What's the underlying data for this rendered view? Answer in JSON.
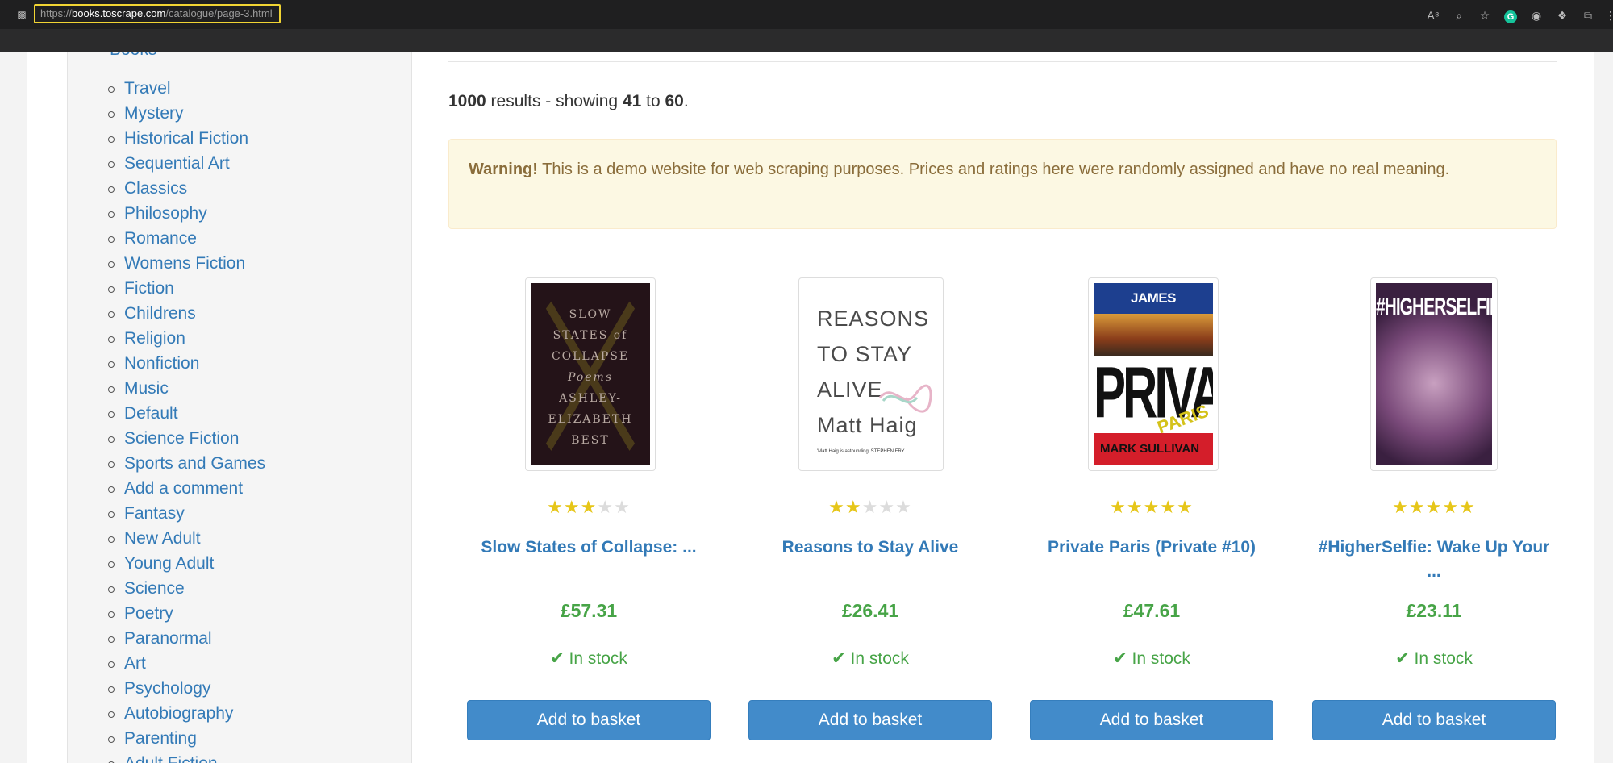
{
  "browser": {
    "url_scheme": "https://",
    "url_host": "books.toscrape.com",
    "url_path": "/catalogue/page-3.html"
  },
  "sidebar": {
    "books_label": "Books",
    "categories": [
      "Travel",
      "Mystery",
      "Historical Fiction",
      "Sequential Art",
      "Classics",
      "Philosophy",
      "Romance",
      "Womens Fiction",
      "Fiction",
      "Childrens",
      "Religion",
      "Nonfiction",
      "Music",
      "Default",
      "Science Fiction",
      "Sports and Games",
      "Add a comment",
      "Fantasy",
      "New Adult",
      "Young Adult",
      "Science",
      "Poetry",
      "Paranormal",
      "Art",
      "Psychology",
      "Autobiography",
      "Parenting",
      "Adult Fiction"
    ]
  },
  "results": {
    "total": "1000",
    "text1": " results - showing ",
    "from": "41",
    "text2": " to ",
    "to": "60",
    "text3": "."
  },
  "alert": {
    "strong": "Warning!",
    "text": " This is a demo website for web scraping purposes. Prices and ratings here were randomly assigned and have no real meaning."
  },
  "products": [
    {
      "title": "Slow States of Collapse: ...",
      "rating": 3,
      "price": "£57.31",
      "stock": "In stock",
      "button": "Add to basket",
      "cover_lines": [
        "SLOW",
        "STATES of",
        "COLLAPSE",
        "Poems",
        "ASHLEY-",
        "ELIZABETH",
        "BEST"
      ]
    },
    {
      "title": "Reasons to Stay Alive",
      "rating": 2,
      "price": "£26.41",
      "stock": "In stock",
      "button": "Add to basket",
      "cover_lines": [
        "REASONS",
        "TO STAY",
        "ALIVE",
        "Matt Haig"
      ],
      "cover_small": "'Matt Haig is astounding' STEPHEN FRY"
    },
    {
      "title": "Private Paris (Private #10)",
      "rating": 5,
      "price": "£47.61",
      "stock": "In stock",
      "button": "Add to basket",
      "cover_author": "JAMES PATTERSON",
      "cover_title": "PRIVATE",
      "cover_sub": "PARIS",
      "cover_coauthor": "MARK SULLIVAN"
    },
    {
      "title": "#HigherSelfie: Wake Up Your ...",
      "rating": 5,
      "price": "£23.11",
      "stock": "In stock",
      "button": "Add to basket",
      "cover_title": "#HIGHERSELFIE"
    }
  ],
  "colors": {
    "link": "#337ab7",
    "price": "#47a447",
    "button": "#428bca",
    "star_on": "#e6c619",
    "star_off": "#dcdcdc",
    "alert_bg": "#fcf8e3"
  }
}
